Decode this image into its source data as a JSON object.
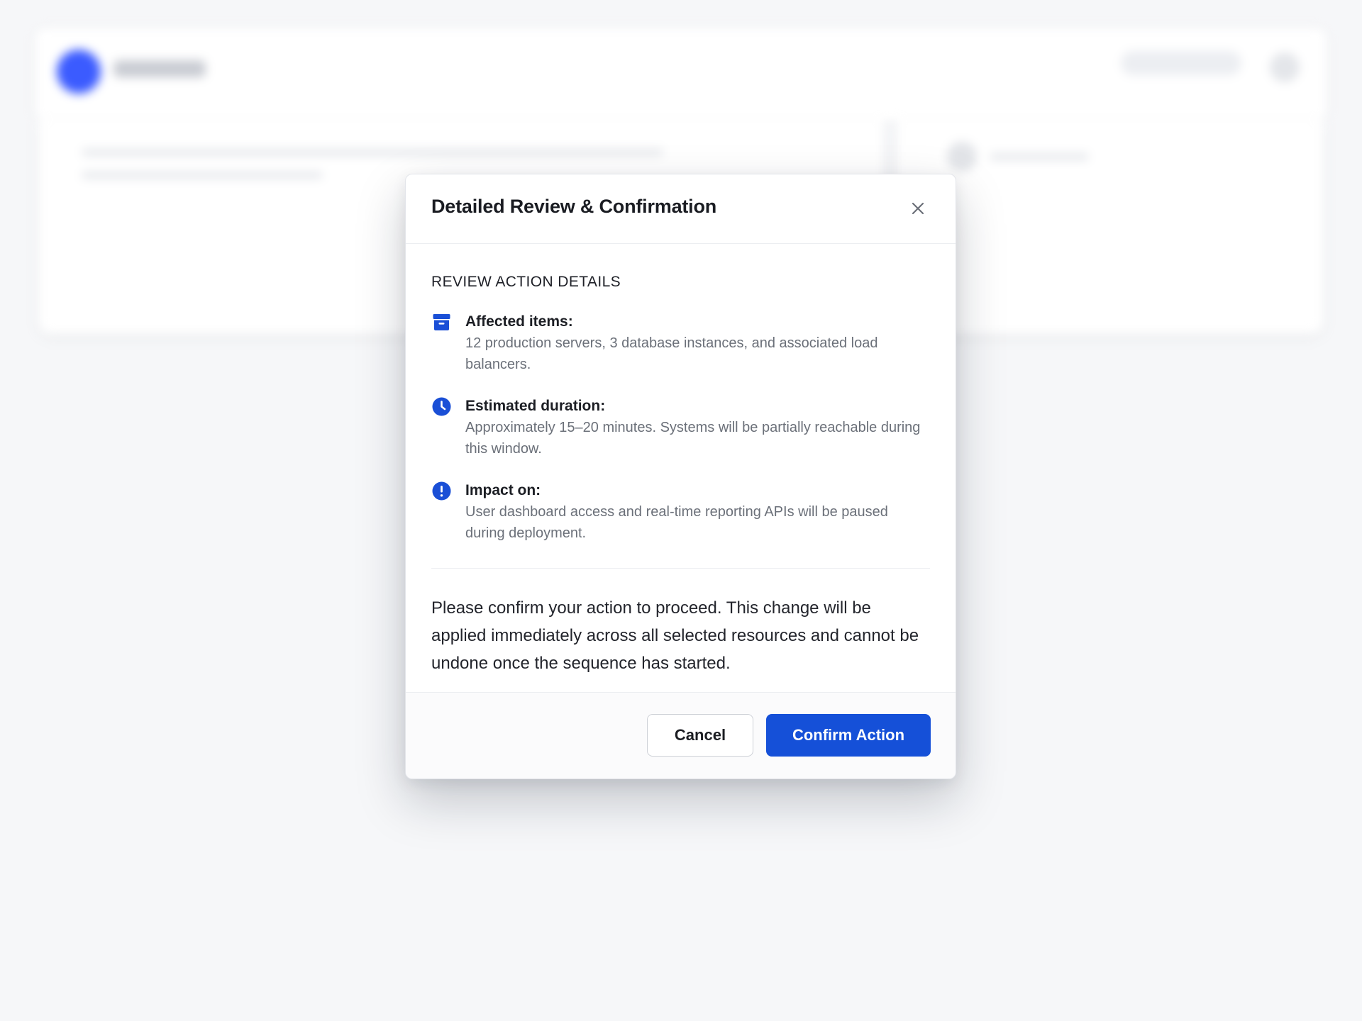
{
  "modal": {
    "title": "Detailed Review & Confirmation",
    "section_title": "REVIEW ACTION DETAILS",
    "details": [
      {
        "icon": "archive-box-icon",
        "label": "Affected items:",
        "text": "12 production servers, 3 database instances, and associated load balancers."
      },
      {
        "icon": "clock-icon",
        "label": "Estimated duration:",
        "text": "Approximately 15–20 minutes. Systems will be partially reachable during this window."
      },
      {
        "icon": "alert-circle-icon",
        "label": "Impact on:",
        "text": "User dashboard access and real-time reporting APIs will be paused during deployment."
      }
    ],
    "confirm_message": "Please confirm your action to proceed. This change will be applied immediately across all selected resources and cannot be undone once the sequence has started.",
    "cancel_label": "Cancel",
    "confirm_label": "Confirm Action"
  },
  "colors": {
    "accent": "#1550d8",
    "icon": "#1a4fd6",
    "text_muted": "#6b7079"
  }
}
